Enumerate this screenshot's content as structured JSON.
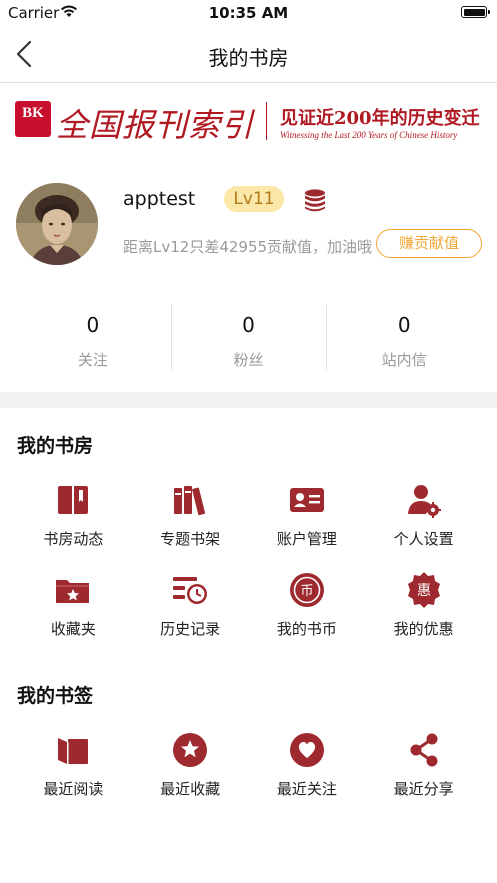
{
  "status_bar": {
    "carrier": "Carrier",
    "time": "10:35 AM"
  },
  "nav": {
    "title": "我的书房"
  },
  "banner": {
    "logo_text": "BK",
    "name": "全国报刊索引",
    "slogan": "见证近200年的历史变迁",
    "slogan_en": "Witnessing the Last 200 Years of Chinese History"
  },
  "profile": {
    "username": "apptest",
    "level": "Lv11",
    "level_hint": "距离Lv12只差42955贡献值，加油哦",
    "earn_button": "赚贡献值"
  },
  "stats": [
    {
      "value": "0",
      "label": "关注"
    },
    {
      "value": "0",
      "label": "粉丝"
    },
    {
      "value": "0",
      "label": "站内信"
    }
  ],
  "study": {
    "title": "我的书房",
    "items": [
      {
        "label": "书房动态",
        "icon": "bookshelf-dynamic-icon"
      },
      {
        "label": "专题书架",
        "icon": "books-icon"
      },
      {
        "label": "账户管理",
        "icon": "id-card-icon"
      },
      {
        "label": "个人设置",
        "icon": "user-gear-icon"
      },
      {
        "label": "收藏夹",
        "icon": "folder-star-icon"
      },
      {
        "label": "历史记录",
        "icon": "history-clock-icon"
      },
      {
        "label": "我的书币",
        "icon": "coin-icon"
      },
      {
        "label": "我的优惠",
        "icon": "discount-badge-icon"
      }
    ]
  },
  "bookmarks": {
    "title": "我的书签",
    "items": [
      {
        "label": "最近阅读",
        "icon": "open-book-icon"
      },
      {
        "label": "最近收藏",
        "icon": "star-circle-icon"
      },
      {
        "label": "最近关注",
        "icon": "heart-circle-icon"
      },
      {
        "label": "最近分享",
        "icon": "share-icon"
      }
    ]
  },
  "colors": {
    "accent": "#9e2a2f",
    "gold": "#f2a838",
    "badge_bg": "#fbe8a8"
  }
}
